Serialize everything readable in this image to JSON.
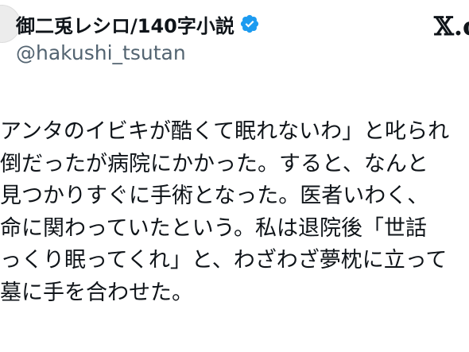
{
  "header": {
    "display_name": "御二兎レシロ/140字小説",
    "handle": "@hakushi_tsutan",
    "verified_icon": "verified-badge-icon",
    "brand_icon": "x-logo-icon",
    "brand_text": "𝕏.c",
    "verified_color": "#1d9bf0"
  },
  "tweet": {
    "lines": [
      "アンタのイビキが酷くて眠れないわ」と叱られ",
      "倒だったが病院にかかった。すると、なんと",
      "見つかりすぐに手術となった。医者いわく、",
      "命に関わっていたという。私は退院後「世話",
      "っくり眠ってくれ」と、わざわざ夢枕に立って",
      "墓に手を合わせた。"
    ]
  }
}
